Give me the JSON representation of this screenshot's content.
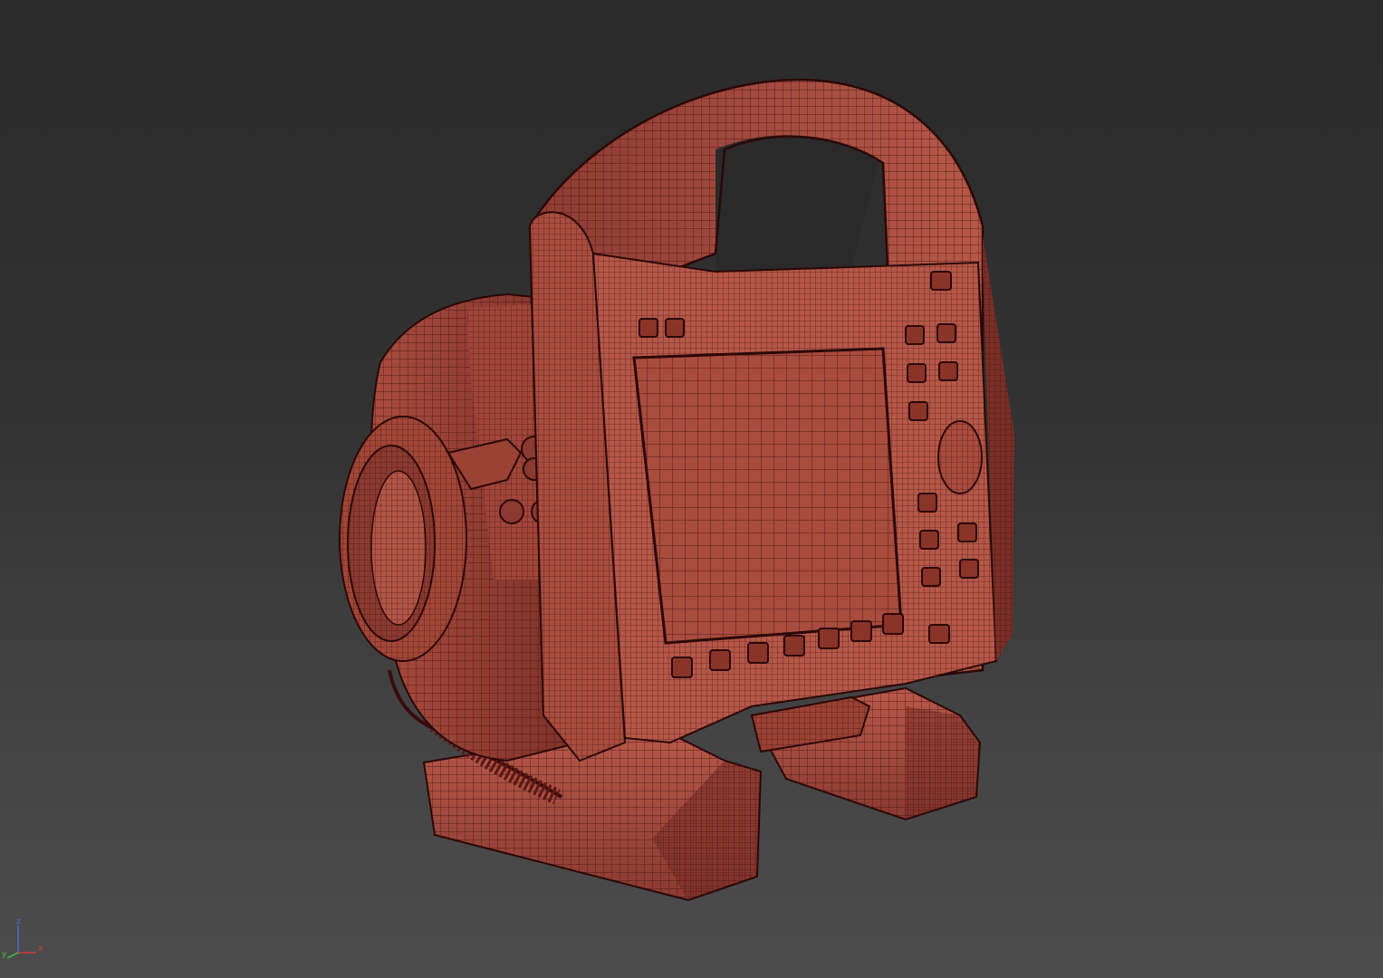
{
  "viewport": {
    "background_top": "#2a2a2a",
    "background_bottom": "#4c4c4c",
    "render_mode": "wireframe-on-shaded",
    "mesh_color": "#b85545",
    "wire_color": "#3a0c0a"
  },
  "model": {
    "kind": "portable defibrillator / patient monitor"
  },
  "axis_gizmo": {
    "x": "x",
    "y": "y",
    "z": "z",
    "x_color": "#d23c3c",
    "y_color": "#3cc83c",
    "z_color": "#4a6ad2"
  }
}
